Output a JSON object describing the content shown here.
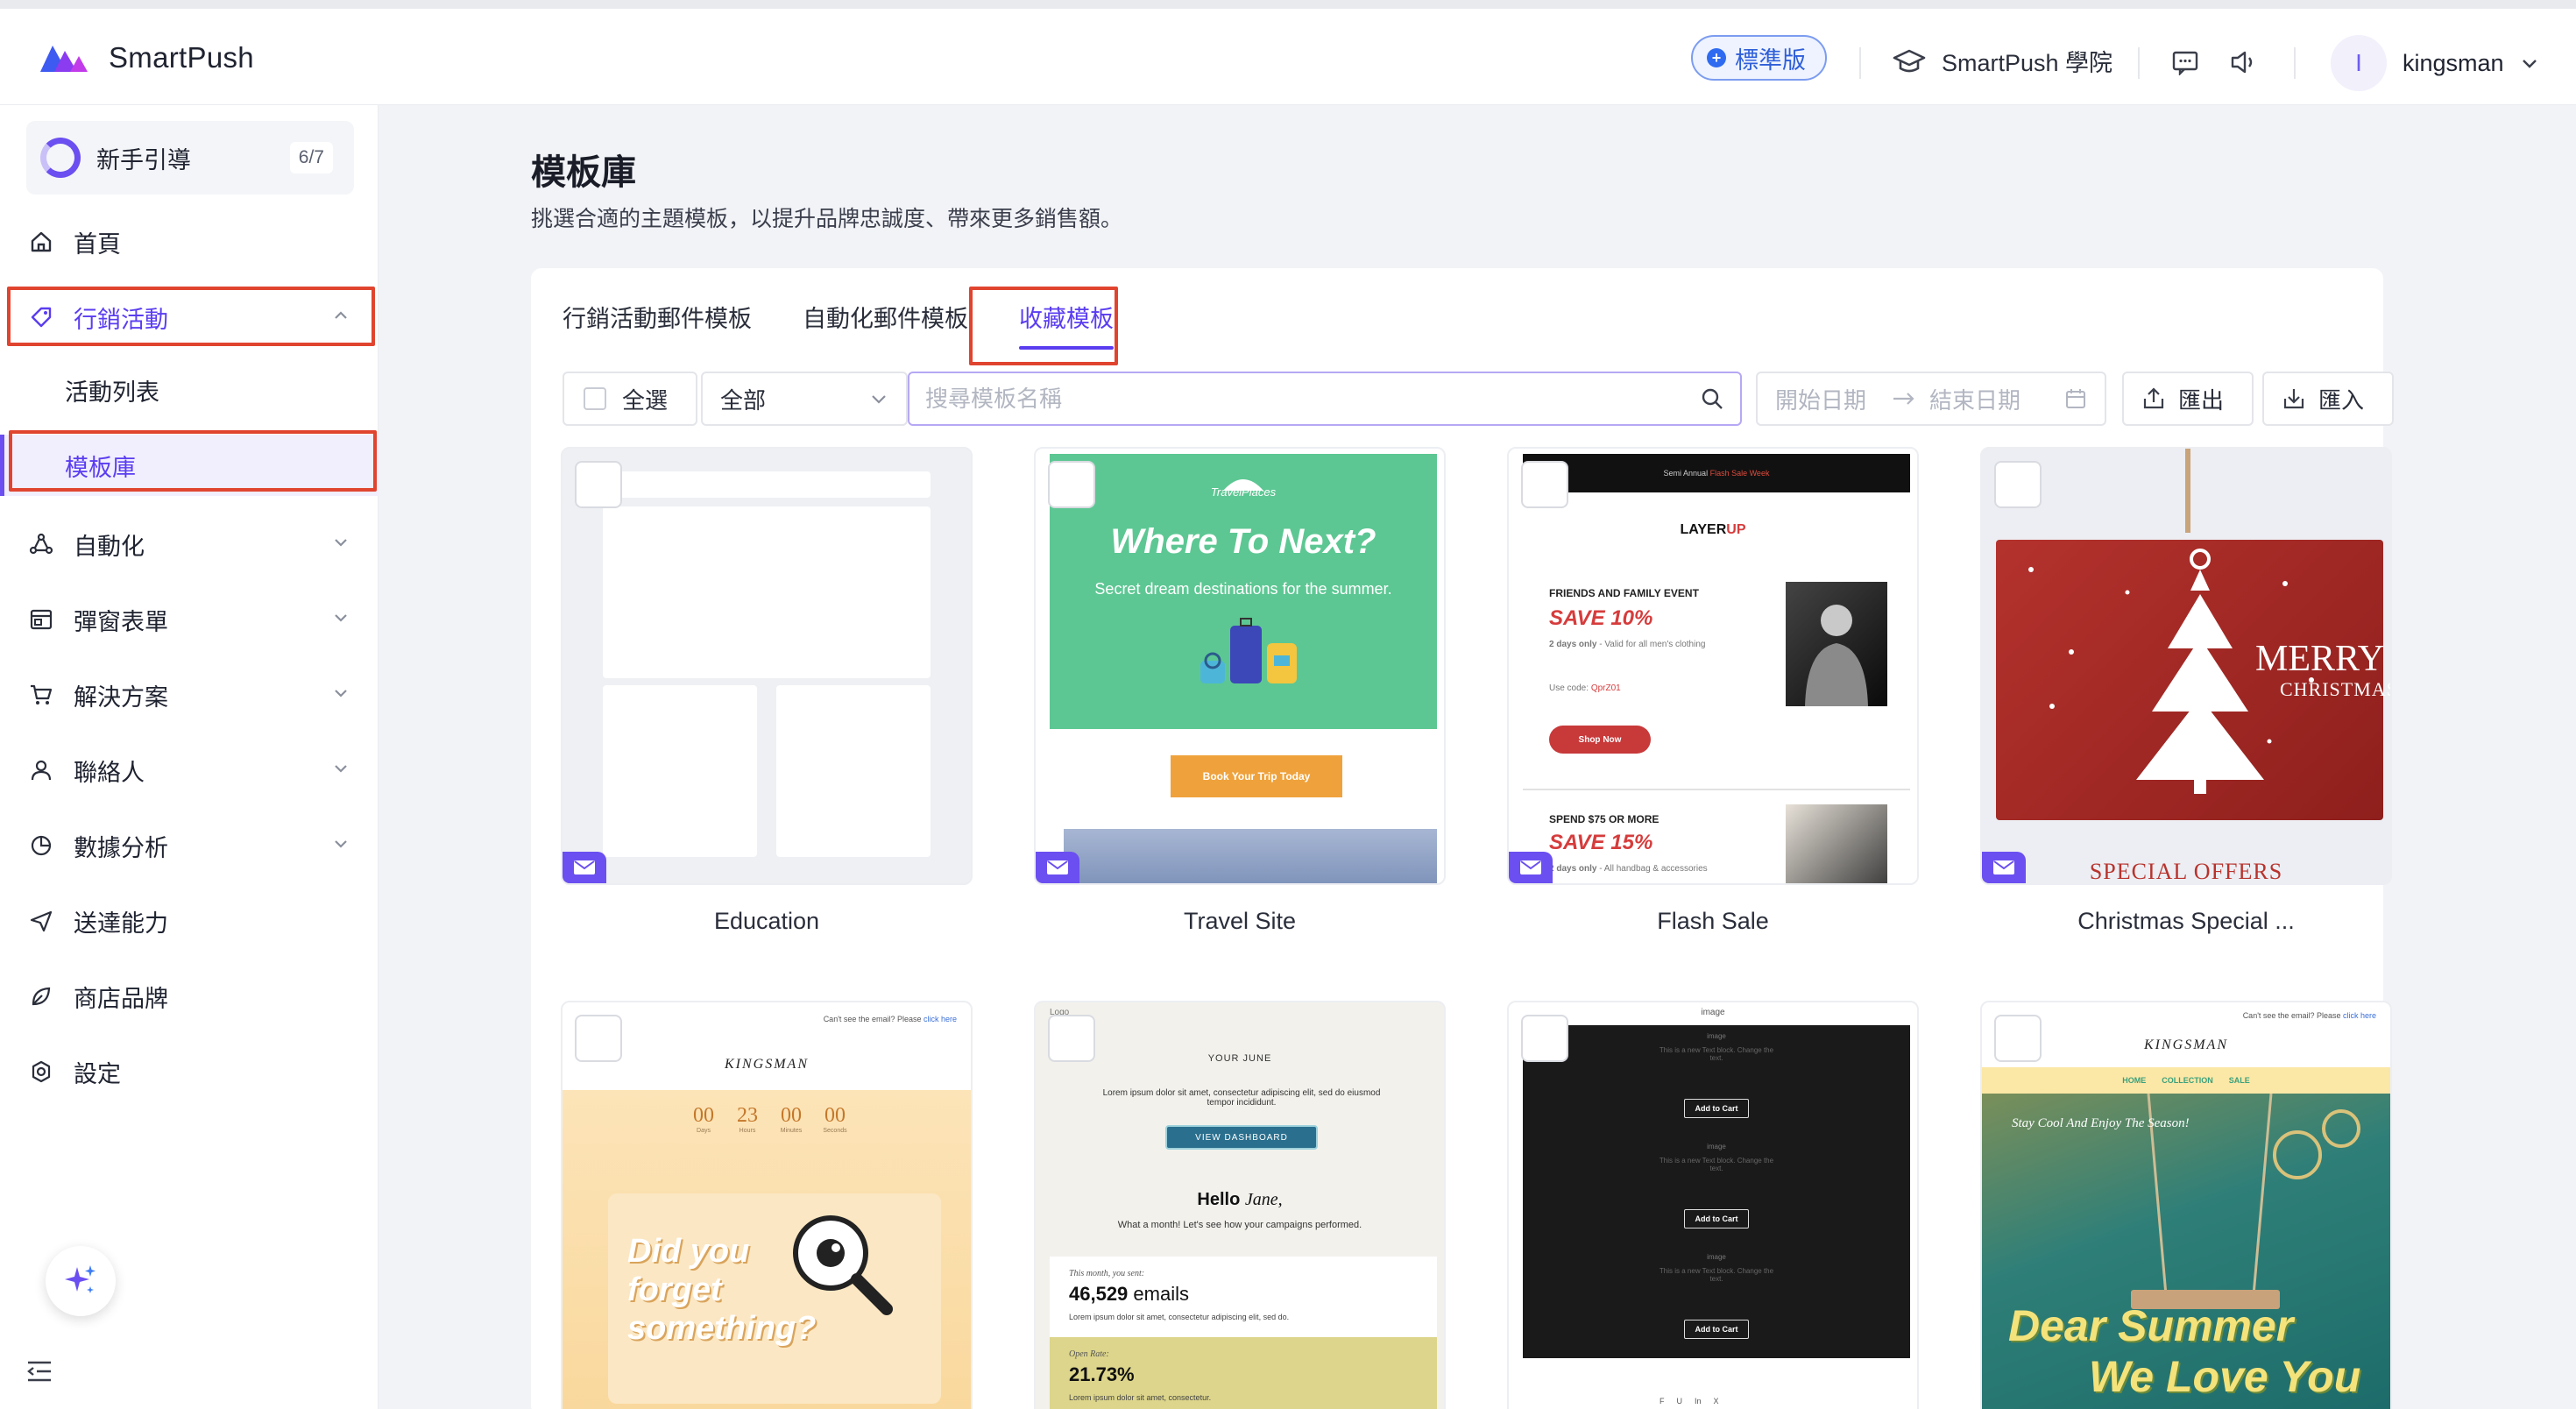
{
  "header": {
    "brand": "SmartPush",
    "plan_badge": "標準版",
    "academy": "SmartPush 學院",
    "avatar_initial": "I",
    "username": "kingsman"
  },
  "sidebar": {
    "guide": {
      "label": "新手引導",
      "count": "6/7"
    },
    "items": [
      {
        "label": "首頁"
      },
      {
        "label": "行銷活動"
      },
      {
        "label": "活動列表"
      },
      {
        "label": "模板庫"
      },
      {
        "label": "自動化"
      },
      {
        "label": "彈窗表單"
      },
      {
        "label": "解決方案"
      },
      {
        "label": "聯絡人"
      },
      {
        "label": "數據分析"
      },
      {
        "label": "送達能力"
      },
      {
        "label": "商店品牌"
      },
      {
        "label": "設定"
      }
    ]
  },
  "page": {
    "title": "模板庫",
    "subtitle": "挑選合適的主題模板，以提升品牌忠誠度、帶來更多銷售額。"
  },
  "tabs": [
    {
      "label": "行銷活動郵件模板"
    },
    {
      "label": "自動化郵件模板"
    },
    {
      "label": "收藏模板"
    }
  ],
  "toolbar": {
    "select_all": "全選",
    "filter_value": "全部",
    "search_placeholder": "搜尋模板名稱",
    "start_date": "開始日期",
    "end_date": "結束日期",
    "export": "匯出",
    "import": "匯入"
  },
  "templates": [
    {
      "name": "Education"
    },
    {
      "name": "Travel Site"
    },
    {
      "name": "Flash Sale"
    },
    {
      "name": "Christmas Special ..."
    }
  ],
  "previews": {
    "travel": {
      "brand": "TravelPlaces",
      "headline": "Where To Next?",
      "sub": "Secret dream destinations for the summer.",
      "cta": "Book Your Trip Today"
    },
    "flash": {
      "topbar_pre": "Semi Annual ",
      "topbar_hl": "Flash Sale Week",
      "brand_a": "LAYER",
      "brand_b": "UP",
      "event": "FRIENDS AND FAMILY EVENT",
      "save1": "SAVE 10%",
      "days1": "2 days only",
      "valid1": " - Valid for all men's clothing",
      "code_label": "Use code: ",
      "code": "QprZ01",
      "shop": "Shop Now",
      "spend": "SPEND $75 OR MORE",
      "save2": "SAVE 15%",
      "days2": "2 days only",
      "valid2": " - All handbag & accessories"
    },
    "christmas": {
      "merry": "MERRY",
      "christmas": "CHRISTMAS",
      "offers": "SPECIAL OFFERS"
    },
    "kingsman1": {
      "notice": "Can't see the email? Please ",
      "notice_link": "click here",
      "brand": "KINGSMAN",
      "cd": [
        "00",
        "23",
        "00",
        "00"
      ],
      "cd_labels": [
        "Days",
        "Hours",
        "Minutes",
        "Seconds"
      ],
      "headline": "Did you forget something?"
    },
    "june": {
      "logo_alt": "Logo",
      "heading": "YOUR JUNE",
      "lorem": "Lorem ipsum dolor sit amet, consectetur adipiscing elit, sed do eiusmod tempor incididunt.",
      "cta": "VIEW DASHBOARD",
      "hello": "Hello ",
      "hello_name": "Jane,",
      "month": "What a month! Let's see how your campaigns performed.",
      "sent_label": "This month, you sent:",
      "emails": "46,529",
      "emails_unit": " emails",
      "lorem2": "Lorem ipsum dolor sit amet, consectetur adipiscing elit, sed do.",
      "open_label": "Open Rate:",
      "open_rate": "21.73%",
      "lorem3": "Lorem ipsum dolor sit amet, consectetur."
    },
    "dark": {
      "img": "image",
      "text": "This is a new Text block. Change the text.",
      "cart": "Add to Cart",
      "social": [
        "F",
        "U",
        "In",
        "X"
      ]
    },
    "kingsman2": {
      "notice": "Can't see the email? Please ",
      "notice_link": "click here",
      "brand": "KINGSMAN",
      "nav": [
        "HOME",
        "COLLECTION",
        "SALE"
      ],
      "tagline": "Stay Cool And Enjoy The Season!",
      "line1": "Dear Summer",
      "line2": "We Love You"
    }
  },
  "colors": {
    "accent": "#5b3df0",
    "highlight": "#e0442f"
  }
}
